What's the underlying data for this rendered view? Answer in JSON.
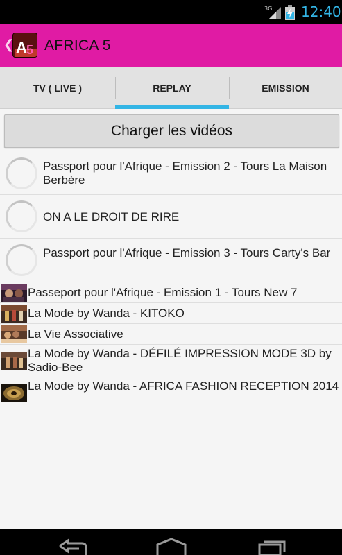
{
  "status_bar": {
    "network": "3G",
    "time": "12:40"
  },
  "action_bar": {
    "title": "AFRICA 5",
    "logo_text": "A5"
  },
  "tabs": [
    {
      "label": "TV ( LIVE )",
      "selected": false
    },
    {
      "label": "REPLAY",
      "selected": true
    },
    {
      "label": "EMISSION",
      "selected": false
    }
  ],
  "load_button": {
    "label": "Charger les vidéos"
  },
  "videos": [
    {
      "title": "Passport pour l'Afrique - Emission 2 - Tours  La Maison Berbère",
      "thumbnail": "loading-spinner"
    },
    {
      "title": "ON A LE DROIT DE RIRE",
      "thumbnail": "loading-spinner"
    },
    {
      "title": "Passport pour l'Afrique - Emission 3 - Tours Carty's Bar",
      "thumbnail": "loading-spinner"
    },
    {
      "title": "Passeport pour l'Afrique - Emission 1 - Tours New 7",
      "thumbnail": "video-thumbnail"
    },
    {
      "title": "La Mode by Wanda - KITOKO",
      "thumbnail": "video-thumbnail"
    },
    {
      "title": "La Vie Associative",
      "thumbnail": "video-thumbnail"
    },
    {
      "title": "La Mode by Wanda - DÉFILÉ IMPRESSION MODE 3D by Sadio-Bee",
      "thumbnail": "video-thumbnail"
    },
    {
      "title": "La Mode by Wanda - AFRICA FASHION RECEPTION 2014",
      "thumbnail": "video-thumbnail"
    }
  ],
  "colors": {
    "action_bar": "#e01ba4",
    "tab_indicator": "#33b5e5",
    "status_text": "#33b5e5"
  }
}
